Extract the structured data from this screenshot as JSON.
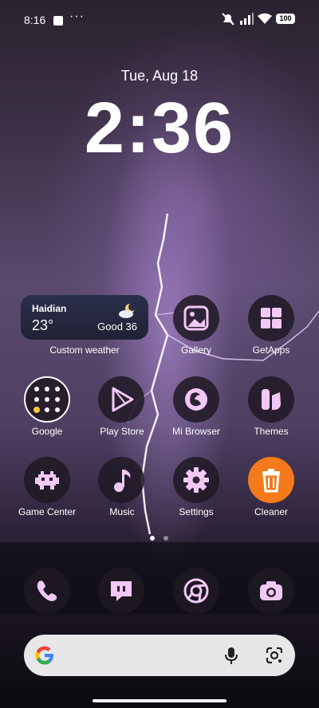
{
  "status_bar": {
    "time": "8:16",
    "dots": "···",
    "battery": "100"
  },
  "lock": {
    "date": "Tue, Aug 18",
    "time": "2:36"
  },
  "weather_widget": {
    "city": "Haidian",
    "temperature": "23°",
    "air_quality": "Good 36",
    "label": "Custom weather"
  },
  "apps": {
    "gallery": "Gallery",
    "getapps": "GetApps",
    "google": "Google",
    "play_store": "Play Store",
    "mi_browser": "Mi Browser",
    "themes": "Themes",
    "game_center": "Game Center",
    "music": "Music",
    "settings": "Settings",
    "cleaner": "Cleaner"
  },
  "dock": [
    "phone-icon",
    "messages-icon",
    "chrome-icon",
    "camera-icon"
  ],
  "colors": {
    "cleaner_bg": "#f47a1b",
    "icon_tint": "#f2c8f6",
    "search_bg": "#e7e7ea"
  }
}
